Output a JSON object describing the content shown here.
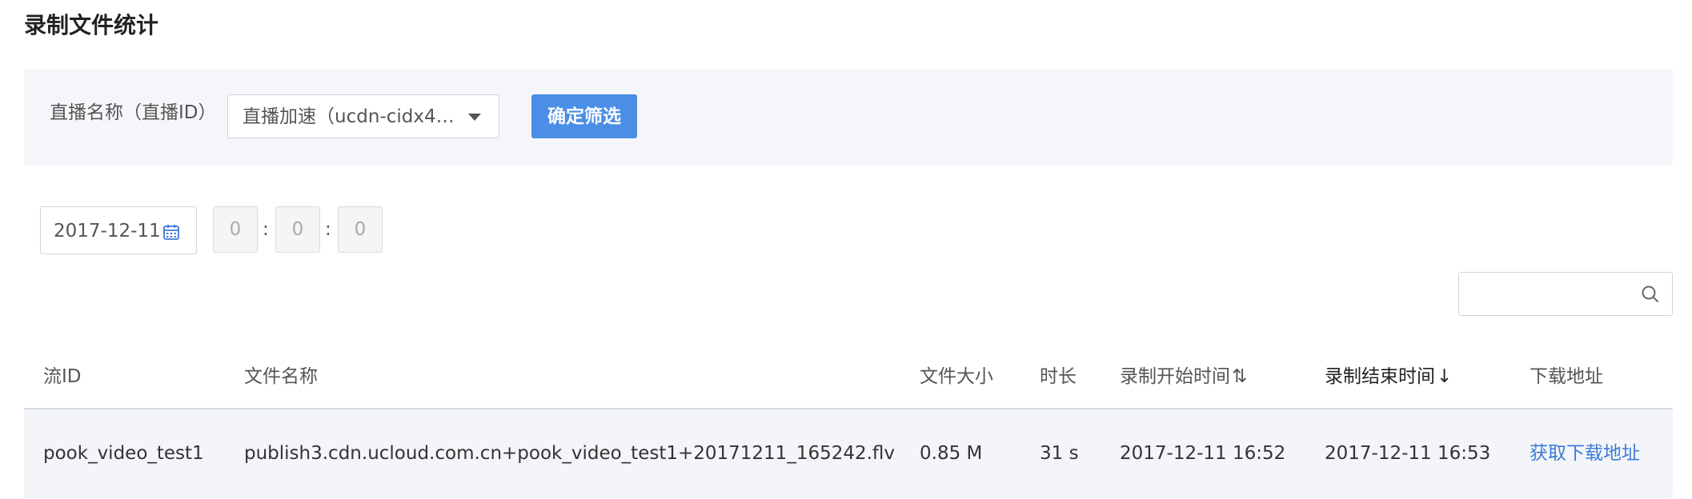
{
  "page": {
    "title": "录制文件统计"
  },
  "filter": {
    "label": "直播名称（直播ID）",
    "select_value": "直播加速（ucdn-cidx4…",
    "confirm_label": "确定筛选"
  },
  "time": {
    "date": "2017-12-11",
    "hour": "0",
    "minute": "0",
    "second": "0",
    "separator": ":"
  },
  "search": {
    "placeholder": "",
    "value": ""
  },
  "table": {
    "headers": {
      "stream_id": "流ID",
      "file_name": "文件名称",
      "file_size": "文件大小",
      "duration": "时长",
      "start_time": "录制开始时间",
      "start_sort_icon": "⇅",
      "end_time": "录制结束时间",
      "end_sort_icon": "↓",
      "download": "下载地址"
    },
    "rows": [
      {
        "stream_id": "pook_video_test1",
        "file_name": "publish3.cdn.ucloud.com.cn+pook_video_test1+20171211_165242.flv",
        "file_size": "0.85 M",
        "duration": "31 s",
        "start_time": "2017-12-11 16:52",
        "end_time": "2017-12-11 16:53",
        "download_label": "获取下载地址"
      }
    ]
  },
  "colors": {
    "accent": "#4a8ee6",
    "link": "#3d7ad9",
    "panel_bg": "#f5f6fa"
  }
}
